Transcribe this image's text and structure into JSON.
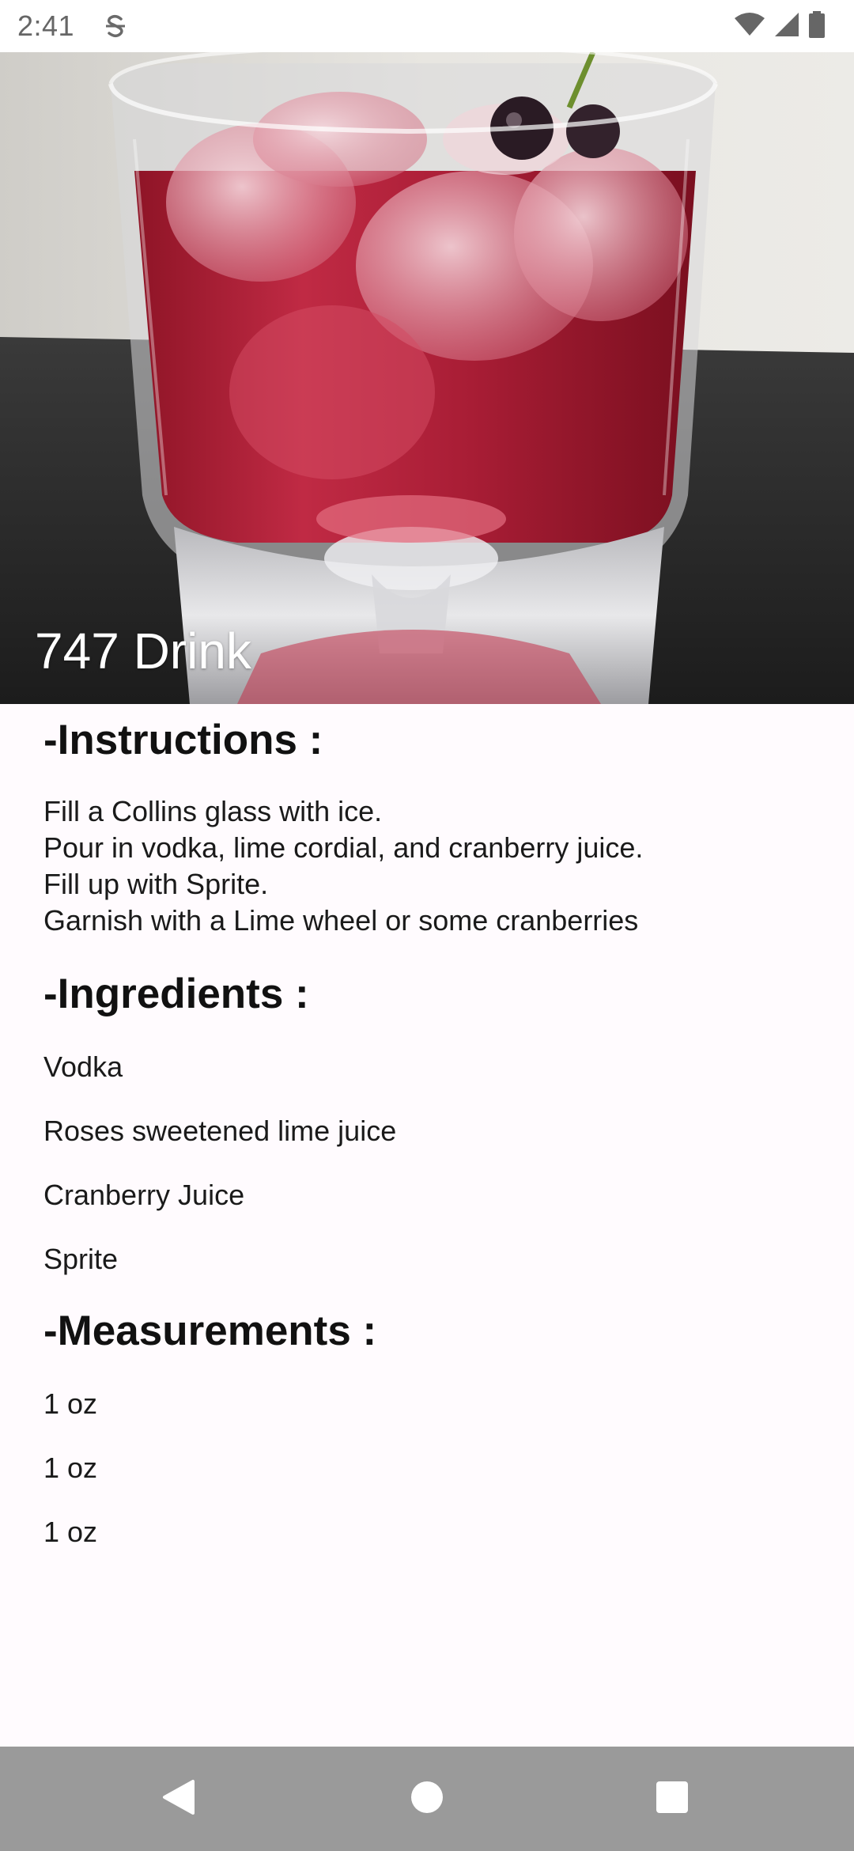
{
  "status_bar": {
    "time": "2:41"
  },
  "hero": {
    "title": "747 Drink"
  },
  "instructions": {
    "heading": "-Instructions :",
    "lines": [
      "Fill a Collins glass with ice.",
      "Pour in vodka, lime cordial, and cranberry juice.",
      "Fill up with Sprite.",
      "Garnish with a Lime wheel or some cranberries"
    ]
  },
  "ingredients": {
    "heading": "-Ingredients :",
    "items": [
      "Vodka",
      "Roses sweetened lime juice",
      "Cranberry Juice",
      "Sprite"
    ]
  },
  "measurements": {
    "heading": "-Measurements :",
    "items": [
      "1 oz",
      "1 oz",
      "1 oz"
    ]
  },
  "nav": {
    "icons": [
      "back-icon",
      "home-icon",
      "recents-icon"
    ]
  },
  "colors": {
    "background": "#fffbfe",
    "nav_bar": "#9a9a9a",
    "drink": "#b3253b"
  }
}
